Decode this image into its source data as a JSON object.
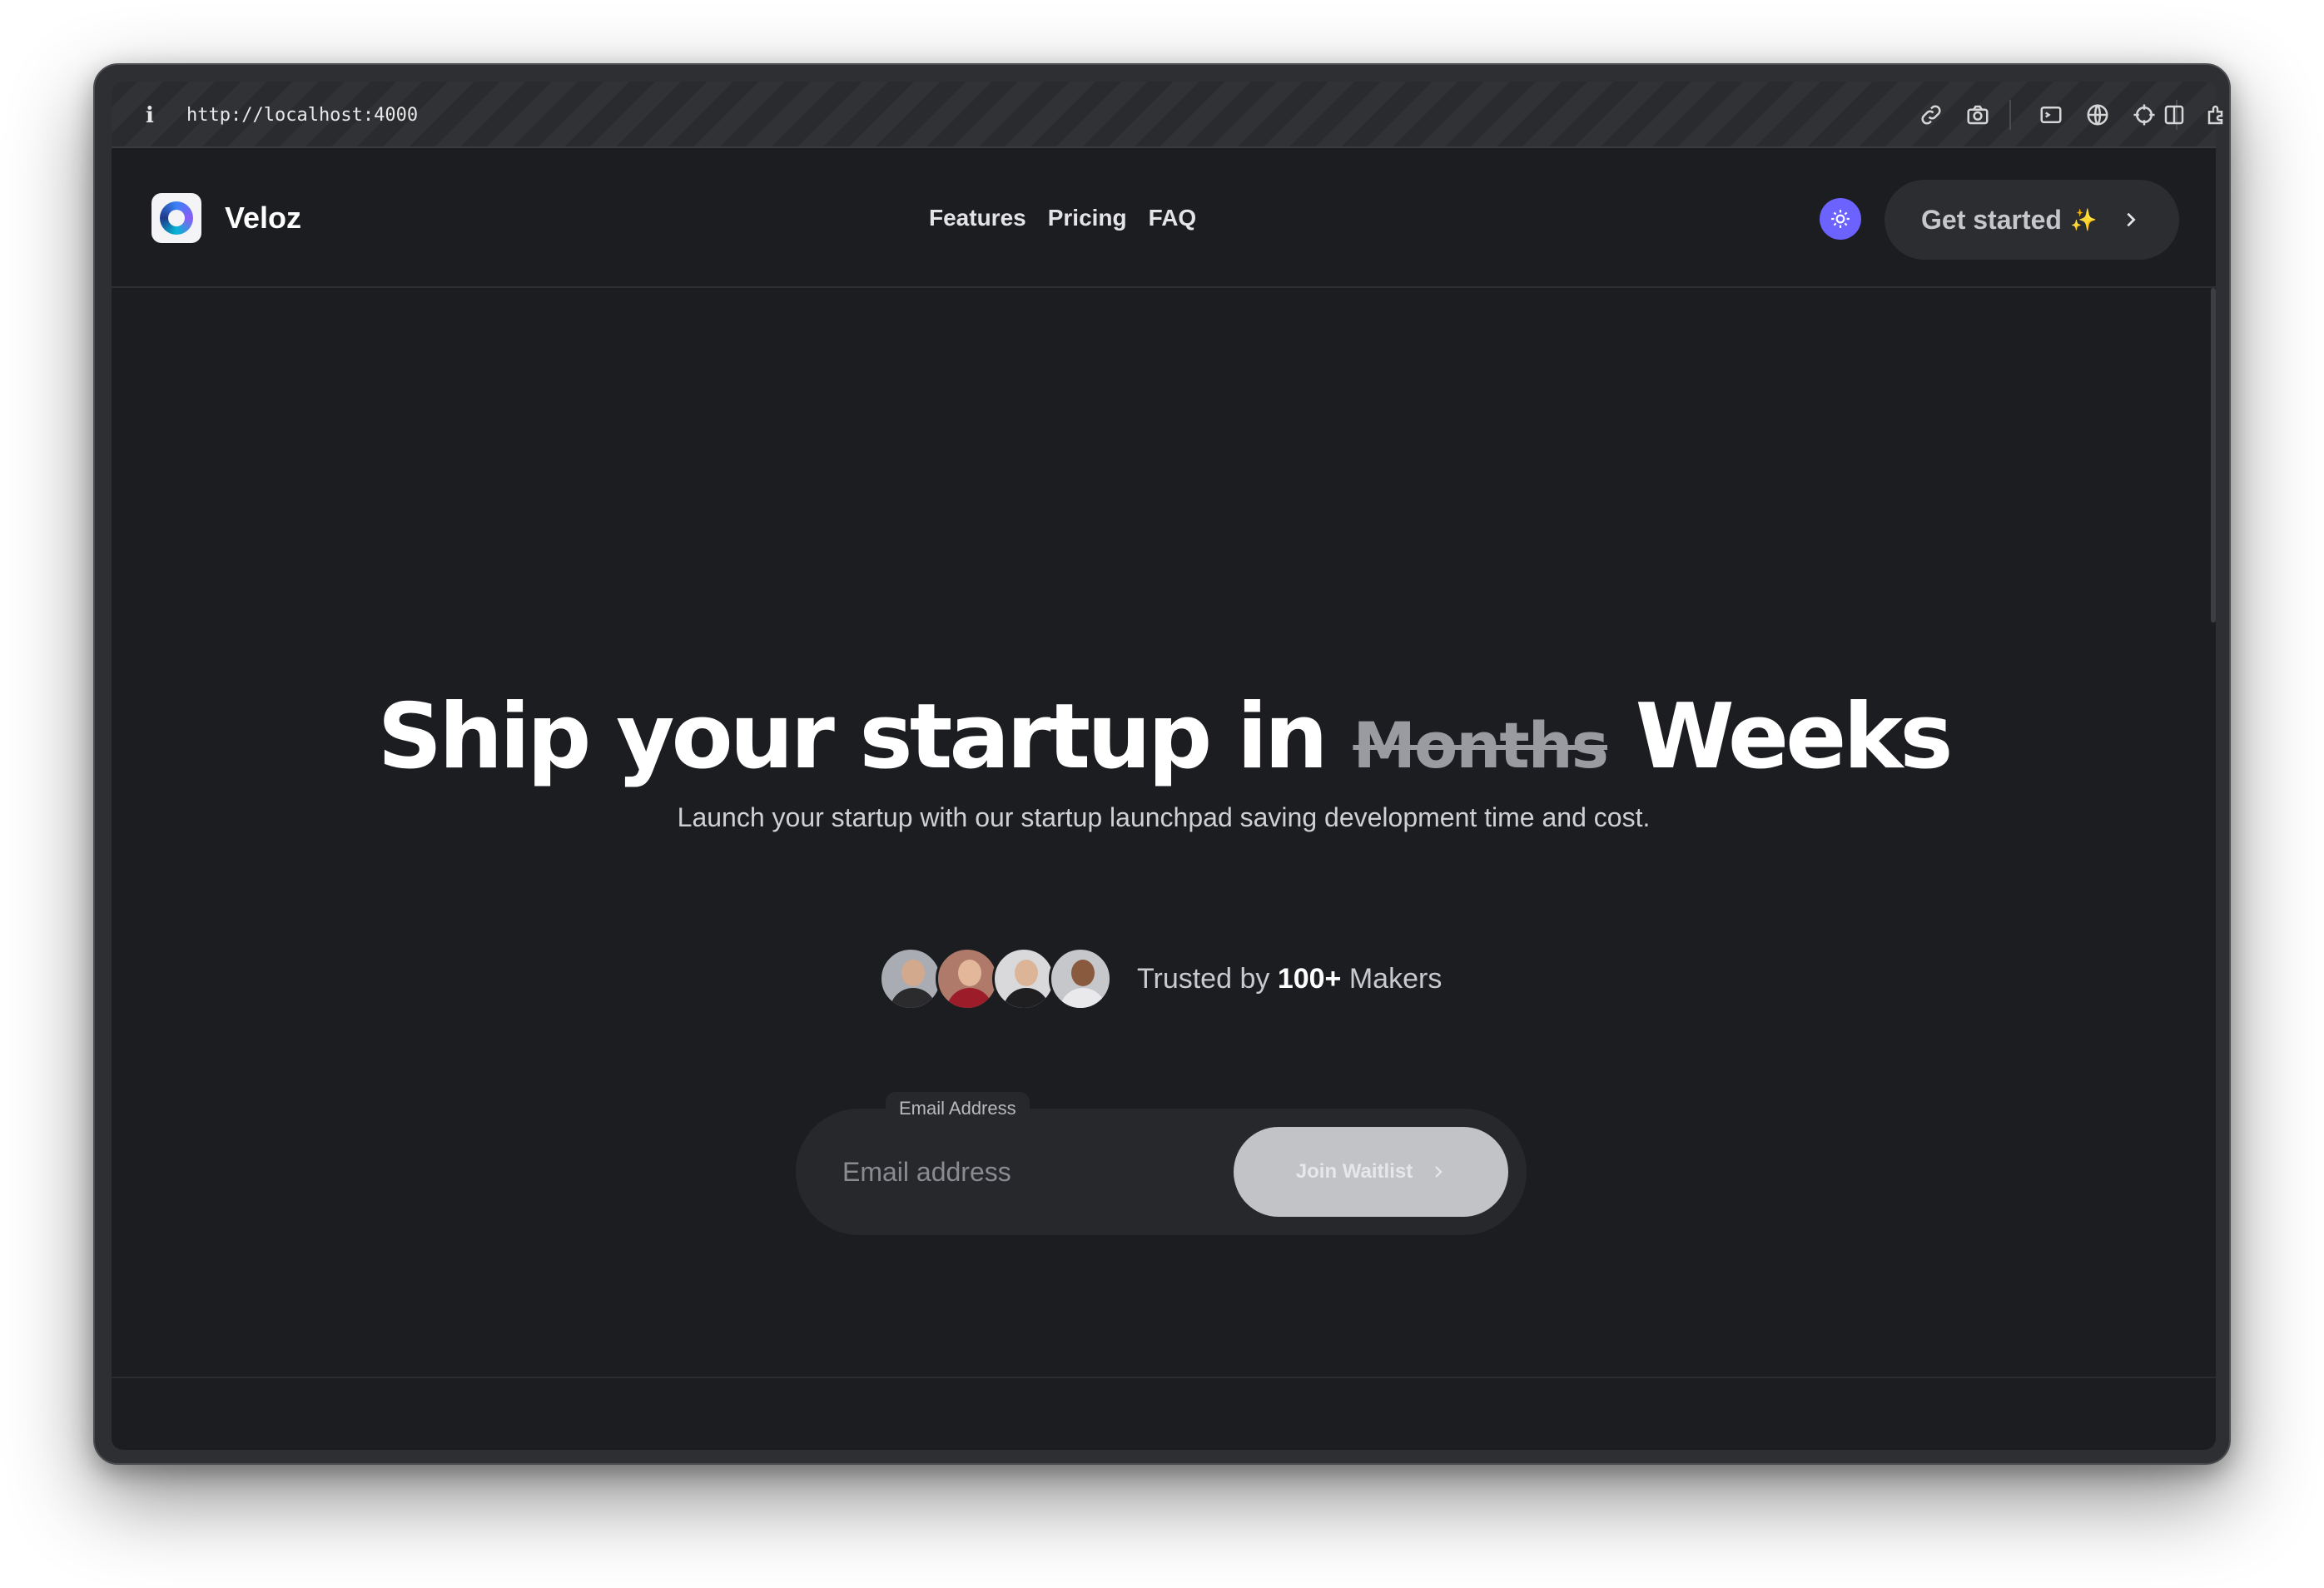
{
  "browser": {
    "url": "http://localhost:4000",
    "toolbar_icons": [
      "link-icon",
      "camera-icon",
      "terminal-icon",
      "globe-icon",
      "crosshair-icon",
      "extension-icon",
      "sidebar-icon"
    ]
  },
  "navbar": {
    "brand": "Veloz",
    "links": [
      "Features",
      "Pricing",
      "FAQ"
    ],
    "cta_label": "Get started",
    "cta_emoji": "✨"
  },
  "hero": {
    "headline_start": "Ship your startup in ",
    "headline_strike": "Months",
    "headline_end": " Weeks",
    "subtitle": "Launch your startup with our startup launchpad saving development time and cost.",
    "trust_prefix": "Trusted by ",
    "trust_count": "100+",
    "trust_suffix": " Makers",
    "avatars": [
      {
        "name": "avatar-1",
        "bg": "#a9acb3",
        "skin": "#d2a98c",
        "shirt": "#2b2b2e"
      },
      {
        "name": "avatar-2",
        "bg": "#b07a6a",
        "skin": "#e2b79a",
        "shirt": "#9c1c2a"
      },
      {
        "name": "avatar-3",
        "bg": "#d9d9dc",
        "skin": "#dcb598",
        "shirt": "#1f1f22"
      },
      {
        "name": "avatar-4",
        "bg": "#c6c7cb",
        "skin": "#8a5a3e",
        "shirt": "#e9e9ec"
      }
    ]
  },
  "form": {
    "label": "Email Address",
    "placeholder": "Email address",
    "button_label": "Join Waitlist"
  },
  "colors": {
    "page_bg": "#1c1d20",
    "accent": "#6c63ff",
    "button_disabled": "#c2c3c7"
  }
}
